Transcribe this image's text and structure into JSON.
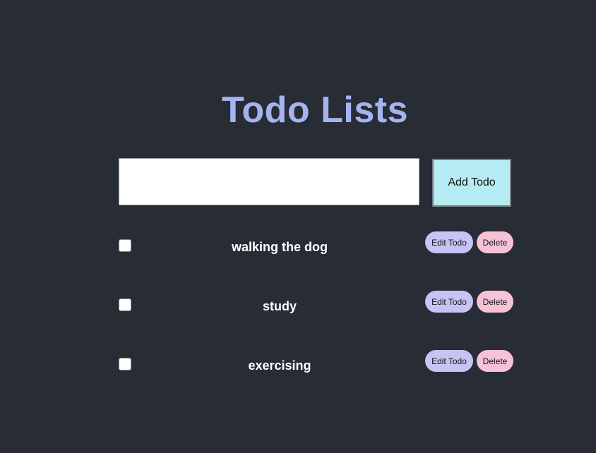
{
  "header": {
    "title": "Todo Lists"
  },
  "form": {
    "input_value": "",
    "input_placeholder": "",
    "add_label": "Add Todo"
  },
  "todos": [
    {
      "text": "walking the dog",
      "checked": false,
      "edit_label": "Edit Todo",
      "delete_label": "Delete"
    },
    {
      "text": "study",
      "checked": false,
      "edit_label": "Edit Todo",
      "delete_label": "Delete"
    },
    {
      "text": "exercising",
      "checked": false,
      "edit_label": "Edit Todo",
      "delete_label": "Delete"
    }
  ],
  "colors": {
    "background": "#282c35",
    "title": "#a4b4f1",
    "add_button": "#b5ecf3",
    "edit_button": "#c7c4f5",
    "delete_button": "#f6c2d8"
  }
}
